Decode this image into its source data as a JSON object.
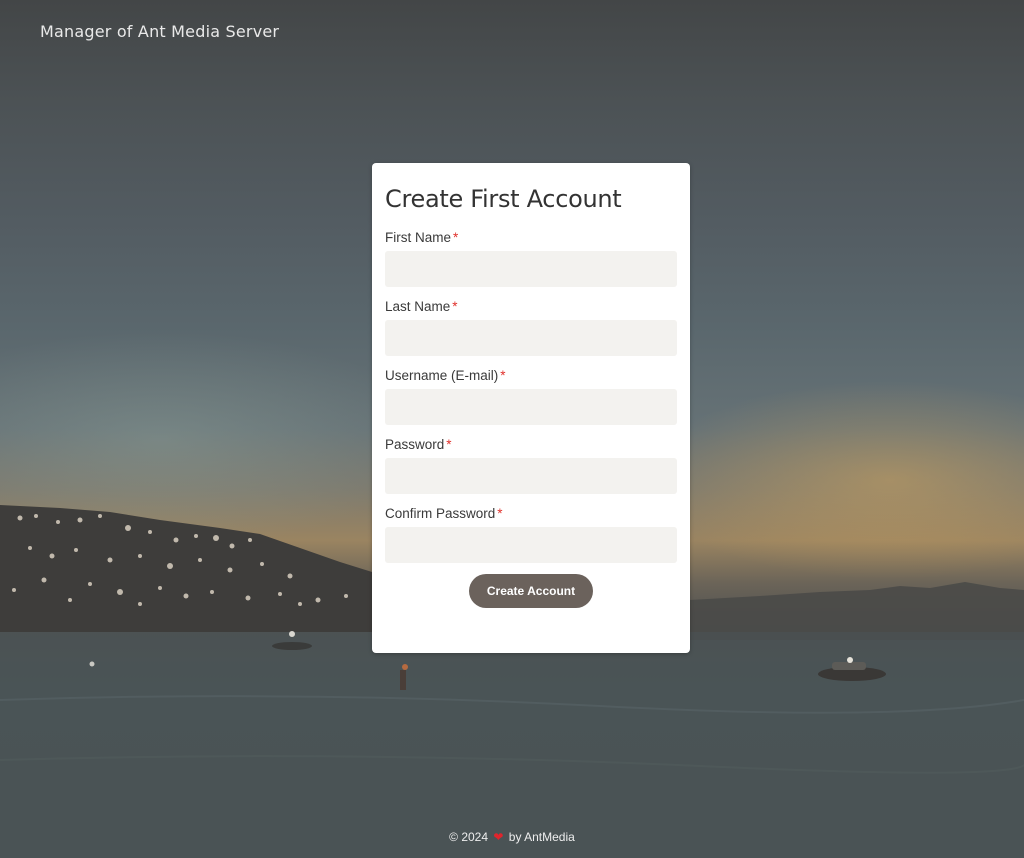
{
  "header": {
    "site_title": "Manager of Ant Media Server"
  },
  "form": {
    "title": "Create First Account",
    "fields": [
      {
        "label": "First Name",
        "required_marker": "*",
        "value": "",
        "placeholder": ""
      },
      {
        "label": "Last Name",
        "required_marker": "*",
        "value": "",
        "placeholder": ""
      },
      {
        "label": "Username (E-mail)",
        "required_marker": "*",
        "value": "",
        "placeholder": ""
      },
      {
        "label": "Password",
        "required_marker": "*",
        "value": "",
        "placeholder": ""
      },
      {
        "label": "Confirm Password",
        "required_marker": "*",
        "value": "",
        "placeholder": ""
      }
    ],
    "submit_label": "Create Account"
  },
  "footer": {
    "copyright": "© 2024",
    "heart_icon": "heart-icon",
    "heart": "❤",
    "byline": "by AntMedia"
  },
  "colors": {
    "button_bg": "#6b625c",
    "input_bg": "#f3f2ef",
    "required": "#e0312b",
    "heart": "#e0242c"
  }
}
